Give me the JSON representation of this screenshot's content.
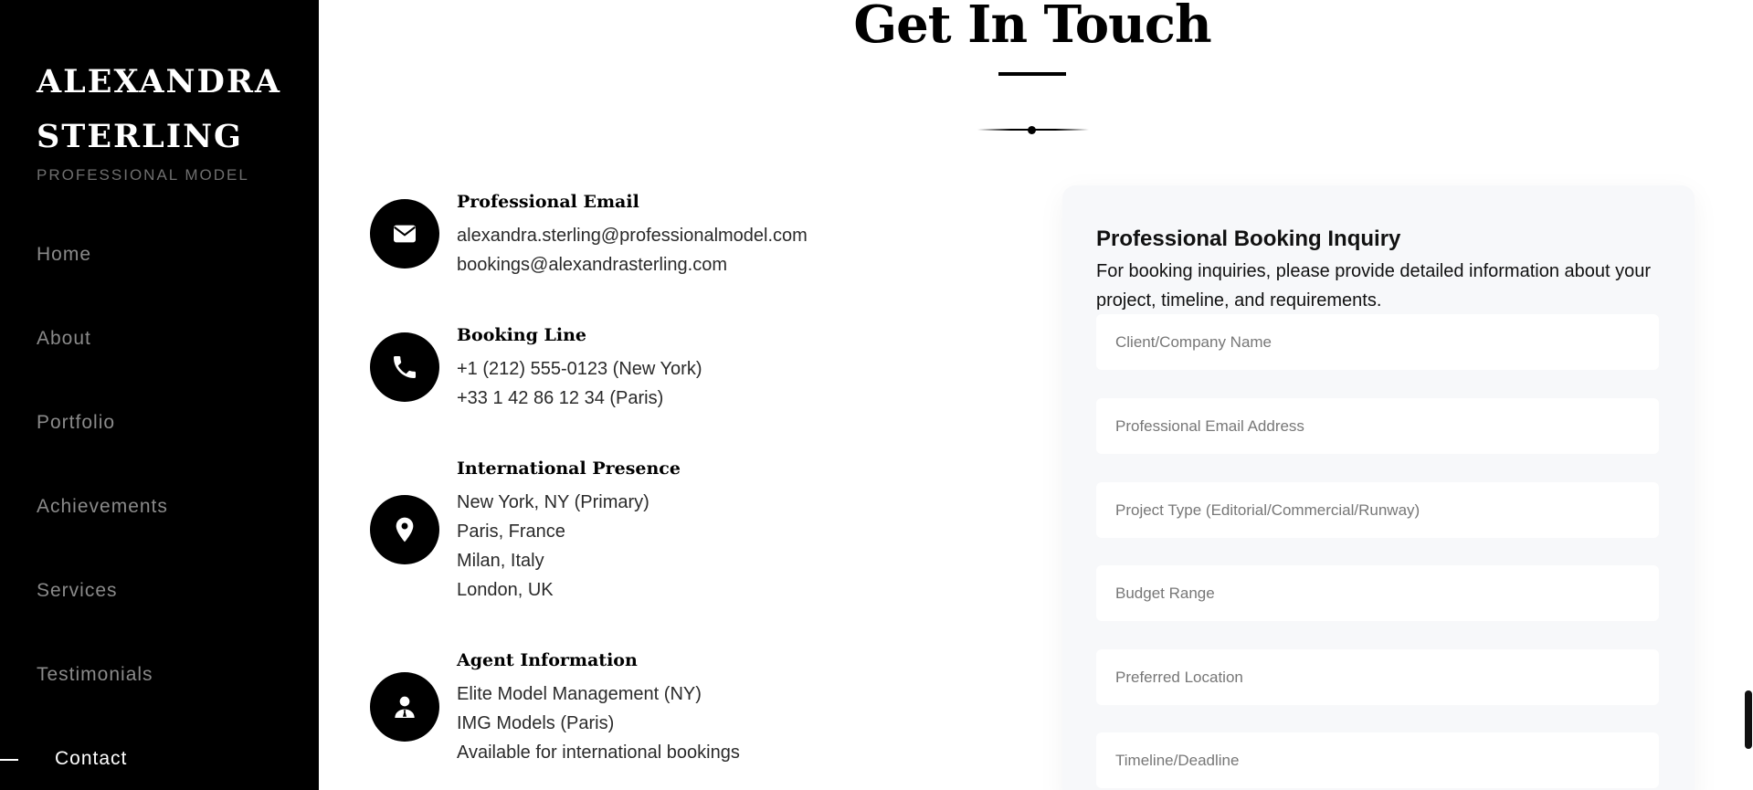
{
  "sidebar": {
    "brand_name": "ALEXANDRA\nSTERLING",
    "brand_subtitle": "PROFESSIONAL MODEL",
    "nav": [
      {
        "label": "Home",
        "active": false
      },
      {
        "label": "About",
        "active": false
      },
      {
        "label": "Portfolio",
        "active": false
      },
      {
        "label": "Achievements",
        "active": false
      },
      {
        "label": "Services",
        "active": false
      },
      {
        "label": "Testimonials",
        "active": false
      },
      {
        "label": "Contact",
        "active": true
      }
    ]
  },
  "header": {
    "title": "Get In Touch"
  },
  "contact_info": [
    {
      "icon": "envelope-icon",
      "heading": "Professional Email",
      "lines": [
        "alexandra.sterling@professionalmodel.com",
        "bookings@alexandrasterling.com"
      ]
    },
    {
      "icon": "phone-icon",
      "heading": "Booking Line",
      "lines": [
        "+1 (212) 555-0123 (New York)",
        "+33 1 42 86 12 34 (Paris)"
      ]
    },
    {
      "icon": "location-pin-icon",
      "heading": "International Presence",
      "lines": [
        "New York, NY (Primary)",
        "Paris, France",
        "Milan, Italy",
        "London, UK"
      ]
    },
    {
      "icon": "agent-icon",
      "heading": "Agent Information",
      "lines": [
        "Elite Model Management (NY)",
        "IMG Models (Paris)",
        "Available for international bookings"
      ]
    }
  ],
  "form": {
    "title": "Professional Booking Inquiry",
    "description": "For booking inquiries, please provide detailed information about your project, timeline, and requirements.",
    "fields": [
      {
        "placeholder": "Client/Company Name",
        "value": ""
      },
      {
        "placeholder": "Professional Email Address",
        "value": ""
      },
      {
        "placeholder": "Project Type (Editorial/Commercial/Runway)",
        "value": ""
      },
      {
        "placeholder": "Budget Range",
        "value": ""
      },
      {
        "placeholder": "Preferred Location",
        "value": ""
      },
      {
        "placeholder": "Timeline/Deadline",
        "value": ""
      }
    ]
  },
  "colors": {
    "sidebar_bg": "#000000",
    "nav_inactive": "#8a8a8a",
    "nav_active": "#ffffff",
    "form_card_bg": "#f7f8fa",
    "icon_circle": "#000000"
  }
}
